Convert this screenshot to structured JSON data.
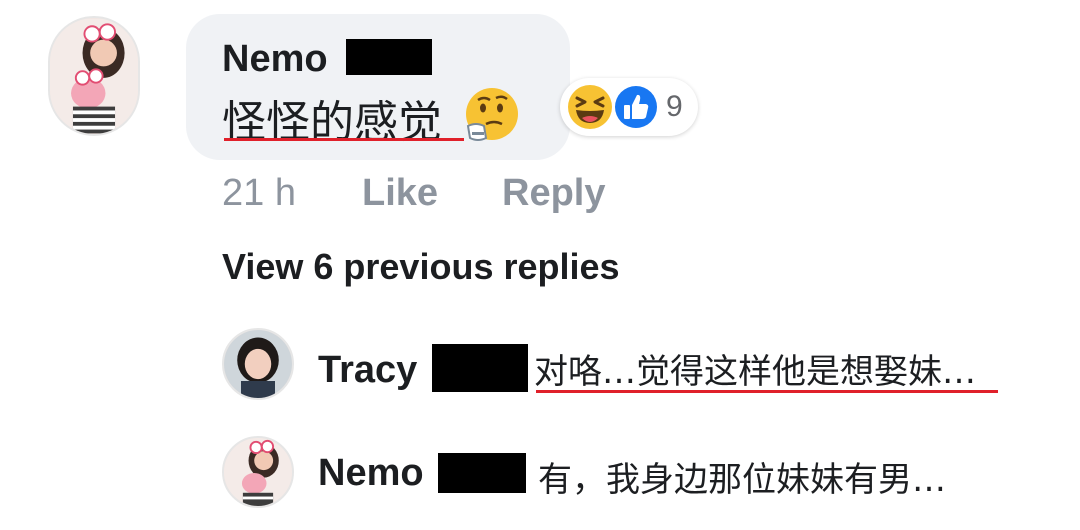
{
  "main_comment": {
    "author": "Nemo",
    "text": "怪怪的感觉",
    "emoji_icon": "thinking-face-icon",
    "reactions": {
      "icons": [
        "laughing-face-icon",
        "thumbs-up-icon"
      ],
      "count": "9"
    },
    "time": "21 h",
    "like_label": "Like",
    "reply_label": "Reply"
  },
  "view_previous_label": "View 6 previous replies",
  "replies": [
    {
      "author": "Tracy",
      "text": "对咯…觉得这样他是想娶妹…"
    },
    {
      "author": "Nemo",
      "text": "有，我身边那位妹妹有男…"
    }
  ],
  "colors": {
    "bubble": "#f0f2f5",
    "meta_text": "#8d949e",
    "name_text": "#1c1e21",
    "highlight_underline": "#e0202a",
    "like_blue": "#1877f2",
    "emoji_yellow": "#f7c233"
  }
}
